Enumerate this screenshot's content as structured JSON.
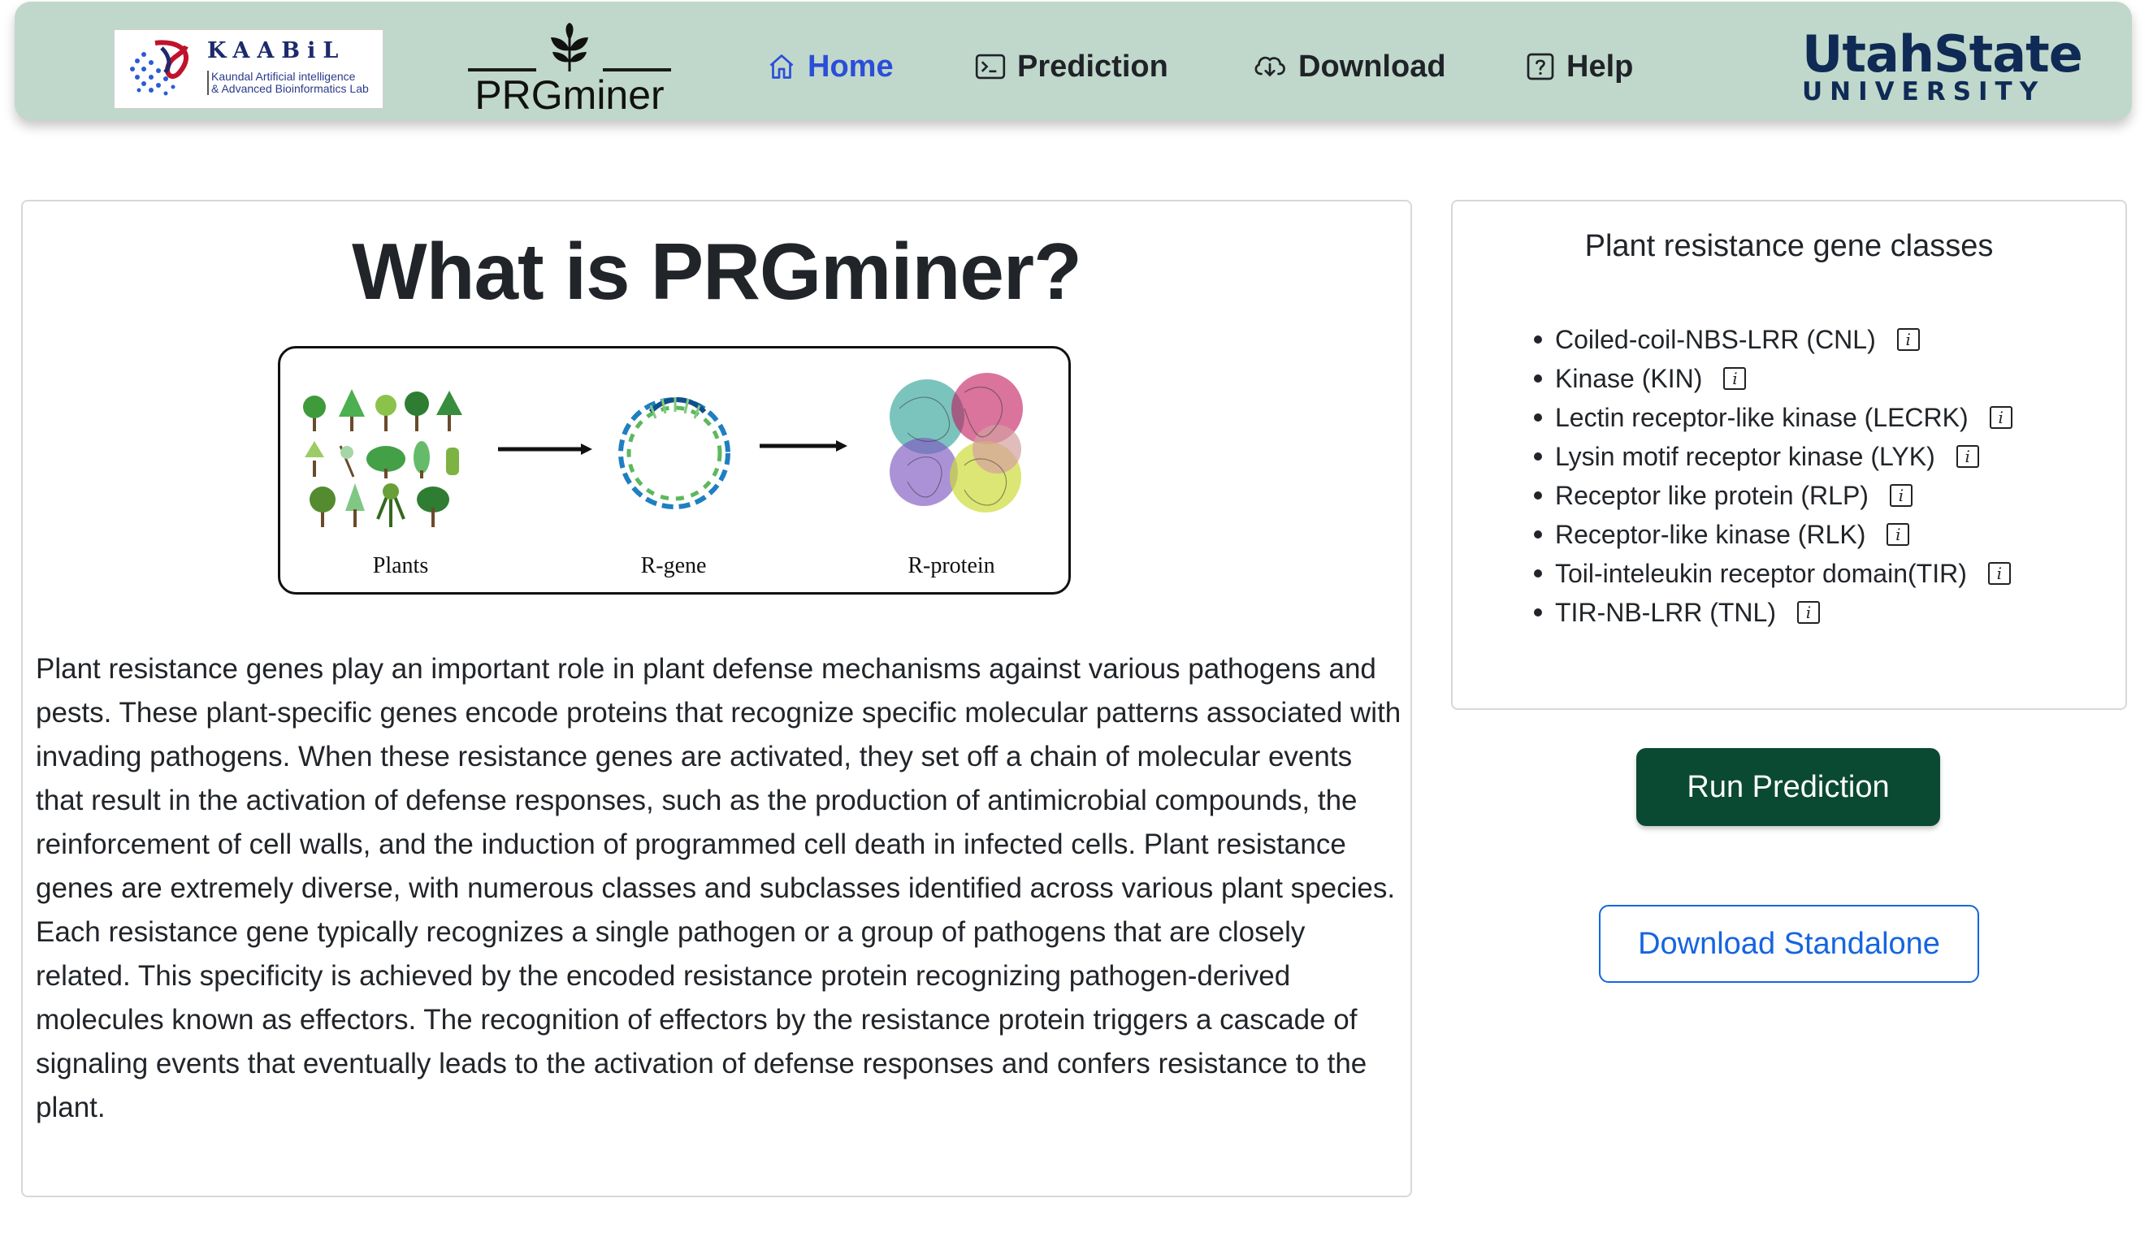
{
  "navbar": {
    "lab_logo": {
      "title": "KAABiL",
      "subtitle_line1": "Kaundal Artificial intelligence",
      "subtitle_line2": "& Advanced Bioinformatics Lab"
    },
    "brand": "PRGminer",
    "items": [
      {
        "label": "Home",
        "icon": "home-icon",
        "active": true
      },
      {
        "label": "Prediction",
        "icon": "terminal-icon"
      },
      {
        "label": "Download",
        "icon": "cloud-download-icon"
      },
      {
        "label": "Help",
        "icon": "question-icon"
      }
    ],
    "university": {
      "line1": "UtahState",
      "line2": "UNIVERSITY"
    }
  },
  "main": {
    "title": "What is PRGminer?",
    "figure": {
      "labels": [
        "Plants",
        "R-gene",
        "R-protein"
      ]
    },
    "paragraph": "Plant resistance genes play an important role in plant defense mechanisms against various pathogens and pests. These plant-specific genes encode proteins that recognize specific molecular patterns associated with invading pathogens. When these resistance genes are activated, they set off a chain of molecular events that result in the activation of defense responses, such as the production of antimicrobial compounds, the reinforcement of cell walls, and the induction of programmed cell death in infected cells. Plant resistance genes are extremely diverse, with numerous classes and subclasses identified across various plant species. Each resistance gene typically recognizes a single pathogen or a group of pathogens that are closely related. This specificity is achieved by the encoded resistance protein recognizing pathogen-derived molecules known as effectors. The recognition of effectors by the resistance protein triggers a cascade of signaling events that eventually leads to the activation of defense responses and confers resistance to the plant."
  },
  "sidebar": {
    "title": "Plant resistance gene classes",
    "classes": [
      "Coiled-coil-NBS-LRR (CNL)",
      "Kinase (KIN)",
      "Lectin receptor-like kinase (LECRK)",
      "Lysin motif receptor kinase (LYK)",
      "Receptor like protein (RLP)",
      "Receptor-like kinase (RLK)",
      "Toil-inteleukin receptor domain(TIR)",
      "TIR-NB-LRR (TNL)"
    ],
    "info_icon_glyph": "i",
    "run_button": "Run Prediction",
    "download_button": "Download Standalone"
  },
  "colors": {
    "navbar_bg": "#c0d8cb",
    "active_nav": "#2b4ed8",
    "run_button_bg": "#0b4a32",
    "download_button": "#1565e0",
    "university": "#0f2a55"
  }
}
